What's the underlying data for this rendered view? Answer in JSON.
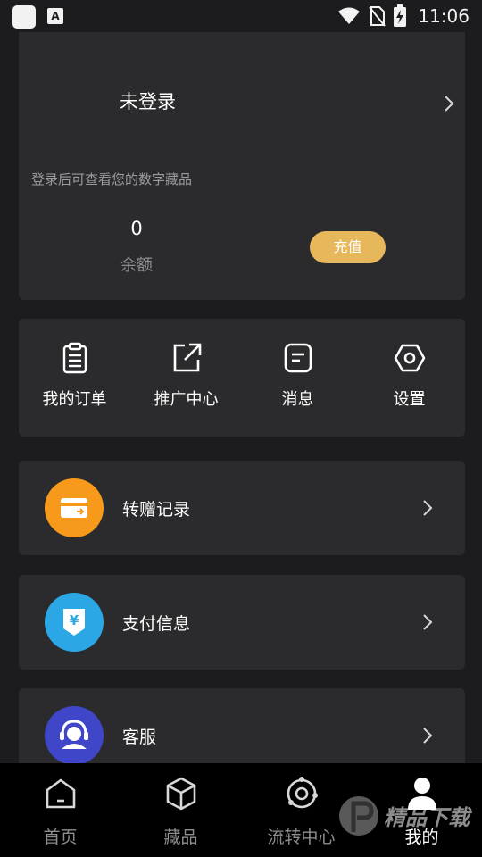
{
  "status_bar": {
    "time": "11:06",
    "icons": [
      "app-square-icon",
      "font-a-icon",
      "wifi-icon",
      "no-sim-icon",
      "battery-charging-icon"
    ]
  },
  "profile": {
    "login_title": "未登录",
    "login_hint": "登录后可查看您的数字藏品",
    "balance_value": "0",
    "balance_label": "余额",
    "recharge_label": "充值",
    "accent_color": "#e7b75b"
  },
  "quick_actions": [
    {
      "label": "我的订单",
      "icon": "clipboard-icon"
    },
    {
      "label": "推广中心",
      "icon": "share-external-icon"
    },
    {
      "label": "消息",
      "icon": "message-icon"
    },
    {
      "label": "设置",
      "icon": "hexagon-settings-icon"
    }
  ],
  "menu_rows": [
    {
      "label": "转赠记录",
      "icon": "transfer-card-icon",
      "color": "#f79a1b"
    },
    {
      "label": "支付信息",
      "icon": "yuan-payment-icon",
      "color": "#2aa7e4"
    },
    {
      "label": "客服",
      "icon": "customer-service-icon",
      "color": "#3f47c8"
    }
  ],
  "bottom_nav": [
    {
      "label": "首页",
      "icon": "home-icon",
      "active": false
    },
    {
      "label": "藏品",
      "icon": "cube-icon",
      "active": false
    },
    {
      "label": "流转中心",
      "icon": "orbit-icon",
      "active": false
    },
    {
      "label": "我的",
      "icon": "user-icon",
      "active": true
    }
  ],
  "watermark_text": "精品下载"
}
